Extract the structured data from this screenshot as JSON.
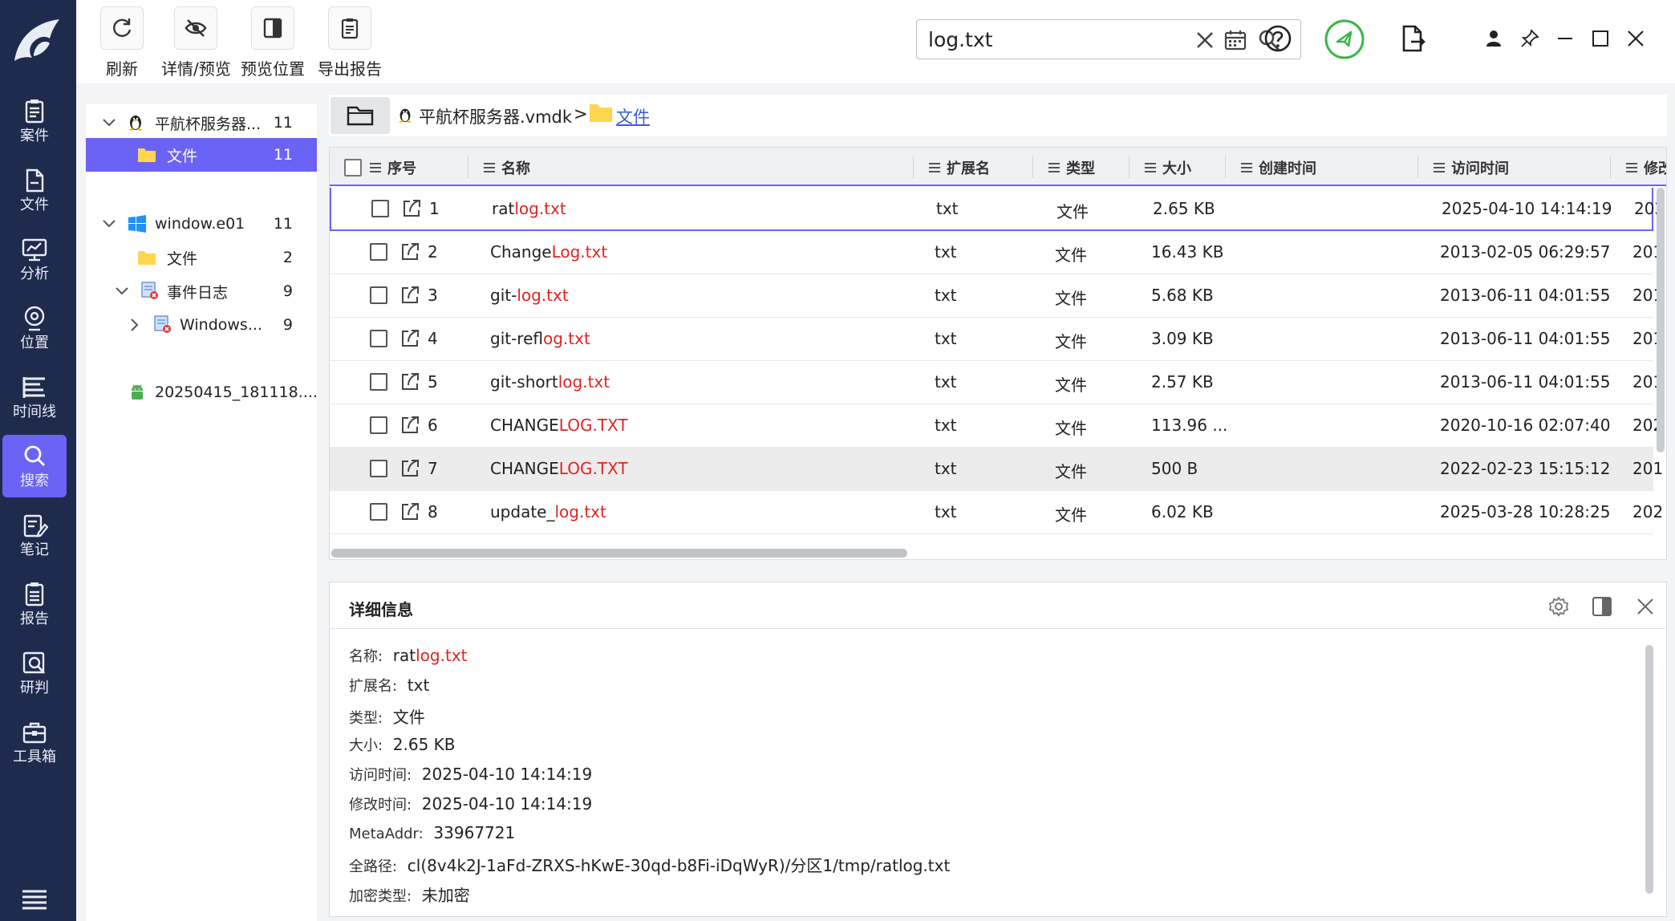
{
  "nav": {
    "items": [
      {
        "label": "案件",
        "icon": "clipboard-icon"
      },
      {
        "label": "文件",
        "icon": "file-icon"
      },
      {
        "label": "分析",
        "icon": "monitor-chart-icon"
      },
      {
        "label": "位置",
        "icon": "location-pin-icon"
      },
      {
        "label": "时间线",
        "icon": "timeline-icon"
      },
      {
        "label": "搜索",
        "icon": "search-icon"
      },
      {
        "label": "笔记",
        "icon": "note-icon"
      },
      {
        "label": "报告",
        "icon": "report-icon"
      },
      {
        "label": "研判",
        "icon": "analysis-icon"
      },
      {
        "label": "工具箱",
        "icon": "toolbox-icon"
      }
    ]
  },
  "toolbar": {
    "refresh": "刷新",
    "details": "详情/预览",
    "preview_pos": "预览位置",
    "export": "导出报告"
  },
  "search": {
    "value": "log.txt"
  },
  "tree": {
    "n1_label": "平航杯服务器...",
    "n1_count": "11",
    "n1_child_label": "文件",
    "n1_child_count": "11",
    "n2_label": "window.e01",
    "n2_count": "11",
    "n2_files_label": "文件",
    "n2_files_count": "2",
    "n2_events_label": "事件日志",
    "n2_events_count": "9",
    "n2_windows_label": "Windows...",
    "n2_windows_count": "9",
    "n3_label": "20250415_181118...."
  },
  "breadcrumb": {
    "disk": "平航杯服务器.vmdk",
    "sep": ">",
    "folder": "文件"
  },
  "table": {
    "headers": {
      "seq": "序号",
      "name": "名称",
      "ext": "扩展名",
      "type": "类型",
      "size": "大小",
      "created": "创建时间",
      "accessed": "访问时间",
      "modified": "修改"
    },
    "rows": [
      {
        "seq": "1",
        "pre": "rat",
        "hit": "log.txt",
        "post": "",
        "ext": "txt",
        "type": "文件",
        "size": "2.65 KB",
        "accessed": "2025-04-10 14:14:19",
        "modified": "202"
      },
      {
        "seq": "2",
        "pre": "Change",
        "hit": "Log.txt",
        "post": "",
        "ext": "txt",
        "type": "文件",
        "size": "16.43 KB",
        "accessed": "2013-02-05 06:29:57",
        "modified": "201"
      },
      {
        "seq": "3",
        "pre": "git-",
        "hit": "log.txt",
        "post": "",
        "ext": "txt",
        "type": "文件",
        "size": "5.68 KB",
        "accessed": "2013-06-11 04:01:55",
        "modified": "201"
      },
      {
        "seq": "4",
        "pre": "git-ref",
        "hit": "log.txt",
        "post": "",
        "ext": "txt",
        "type": "文件",
        "size": "3.09 KB",
        "accessed": "2013-06-11 04:01:55",
        "modified": "201"
      },
      {
        "seq": "5",
        "pre": "git-short",
        "hit": "log.txt",
        "post": "",
        "ext": "txt",
        "type": "文件",
        "size": "2.57 KB",
        "accessed": "2013-06-11 04:01:55",
        "modified": "201"
      },
      {
        "seq": "6",
        "pre": "CHANGE",
        "hit": "LOG.TXT",
        "post": "",
        "ext": "txt",
        "type": "文件",
        "size": "113.96 ...",
        "accessed": "2020-10-16 02:07:40",
        "modified": "202"
      },
      {
        "seq": "7",
        "pre": "CHANGE",
        "hit": "LOG.TXT",
        "post": "",
        "ext": "txt",
        "type": "文件",
        "size": "500 B",
        "accessed": "2022-02-23 15:15:12",
        "modified": "201"
      },
      {
        "seq": "8",
        "pre": "update_",
        "hit": "log.txt",
        "post": "",
        "ext": "txt",
        "type": "文件",
        "size": "6.02 KB",
        "accessed": "2025-03-28 10:28:25",
        "modified": "202"
      }
    ]
  },
  "detail": {
    "title": "详细信息",
    "name_k": "名称:",
    "name_pre": "rat",
    "name_hit": "log.txt",
    "ext_k": "扩展名:",
    "ext_v": "txt",
    "type_k": "类型:",
    "type_v": "文件",
    "size_k": "大小:",
    "size_v": "2.65 KB",
    "access_k": "访问时间:",
    "access_v": "2025-04-10 14:14:19",
    "modify_k": "修改时间:",
    "modify_v": "2025-04-10 14:14:19",
    "meta_k": "MetaAddr:",
    "meta_v": "33967721",
    "path_k": "全路径:",
    "path_v": "cl(8v4k2J-1aFd-ZRXS-hKwE-30qd-b8Fi-iDqWyR)/分区1/tmp/ratlog.txt",
    "enc_k": "加密类型:",
    "enc_v": "未加密"
  },
  "colors": {
    "nav_bg": "#1f2b4d",
    "accent": "#6b63f6",
    "highlight": "#e02424",
    "rocket_green": "#3bb54a"
  }
}
